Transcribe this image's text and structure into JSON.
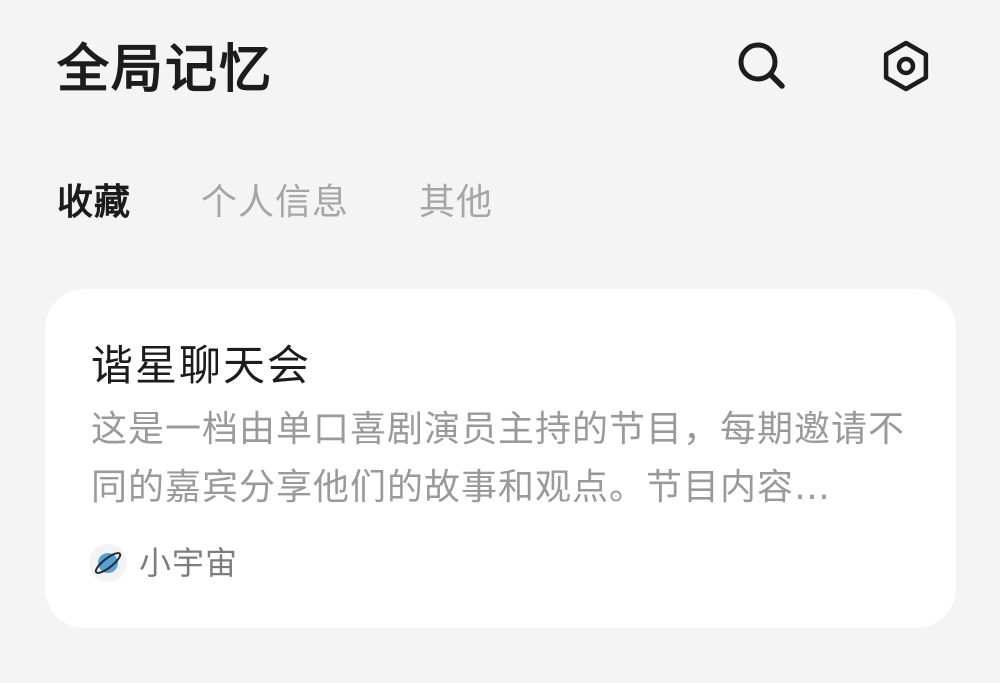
{
  "header": {
    "title": "全局记忆",
    "icons": [
      "search-icon",
      "settings-icon"
    ]
  },
  "tabs": [
    {
      "label": "收藏",
      "active": true
    },
    {
      "label": "个人信息",
      "active": false
    },
    {
      "label": "其他",
      "active": false
    }
  ],
  "card": {
    "title": "谐星聊天会",
    "description": "这是一档由单口喜剧演员主持的节目，每期邀请不同的嘉宾分享他们的故事和观点。节目内容…",
    "source": {
      "icon": "planet-icon",
      "name": "小宇宙"
    }
  },
  "colors": {
    "background": "#f4f4f4",
    "card": "#ffffff",
    "text_primary": "#1c1c1c",
    "text_secondary": "#9a9a9a",
    "tab_inactive": "#a6a6a6",
    "planet_blue": "#5b9fd0"
  }
}
